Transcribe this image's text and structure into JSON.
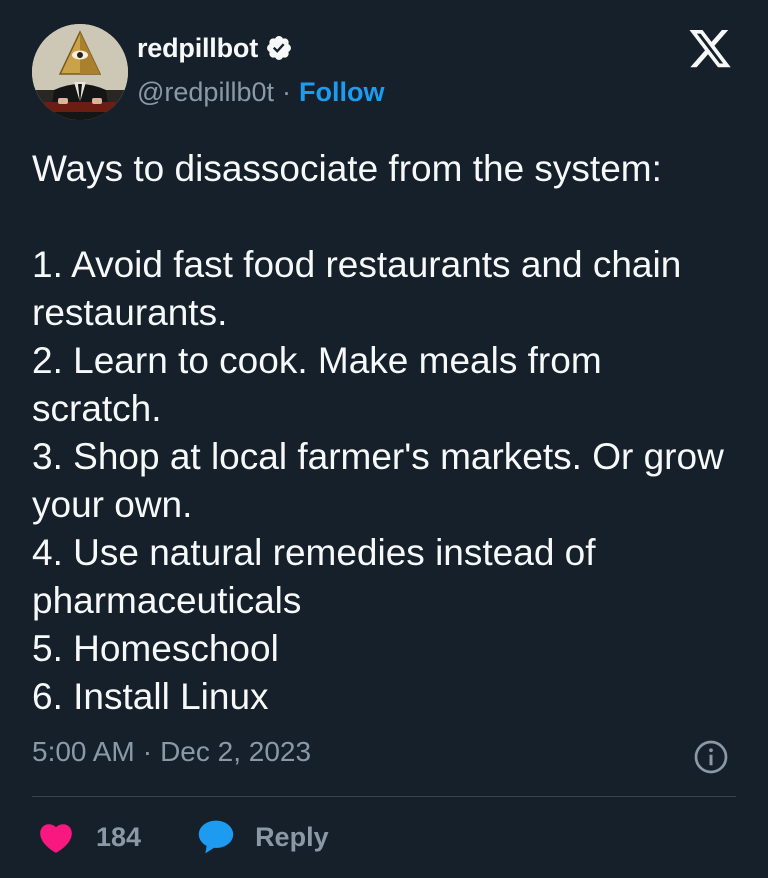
{
  "author": {
    "display_name": "redpillbot",
    "handle": "@redpillb0t",
    "separator": "·",
    "follow_label": "Follow",
    "verified": true,
    "avatar_icon": "illuminati-pyramid-avatar"
  },
  "brand": {
    "logo_icon": "x-logo-icon"
  },
  "tweet": {
    "lines": [
      "Ways to disassociate from the system:",
      "",
      "1. Avoid fast food restaurants and chain restaurants.",
      "2. Learn to cook. Make meals from scratch.",
      "3. Shop at local farmer's markets. Or grow your own.",
      "4. Use natural remedies instead of pharmaceuticals",
      "5. Homeschool",
      "6. Install Linux"
    ],
    "time": "5:00 AM",
    "separator": "·",
    "date": "Dec 2, 2023"
  },
  "actions": {
    "like_count": "184",
    "reply_label": "Reply"
  },
  "colors": {
    "background": "#15202b",
    "text": "#f7f9f9",
    "secondary": "#8b98a5",
    "accent": "#1d9bf0",
    "like": "#f91880",
    "divider": "#38444d"
  }
}
